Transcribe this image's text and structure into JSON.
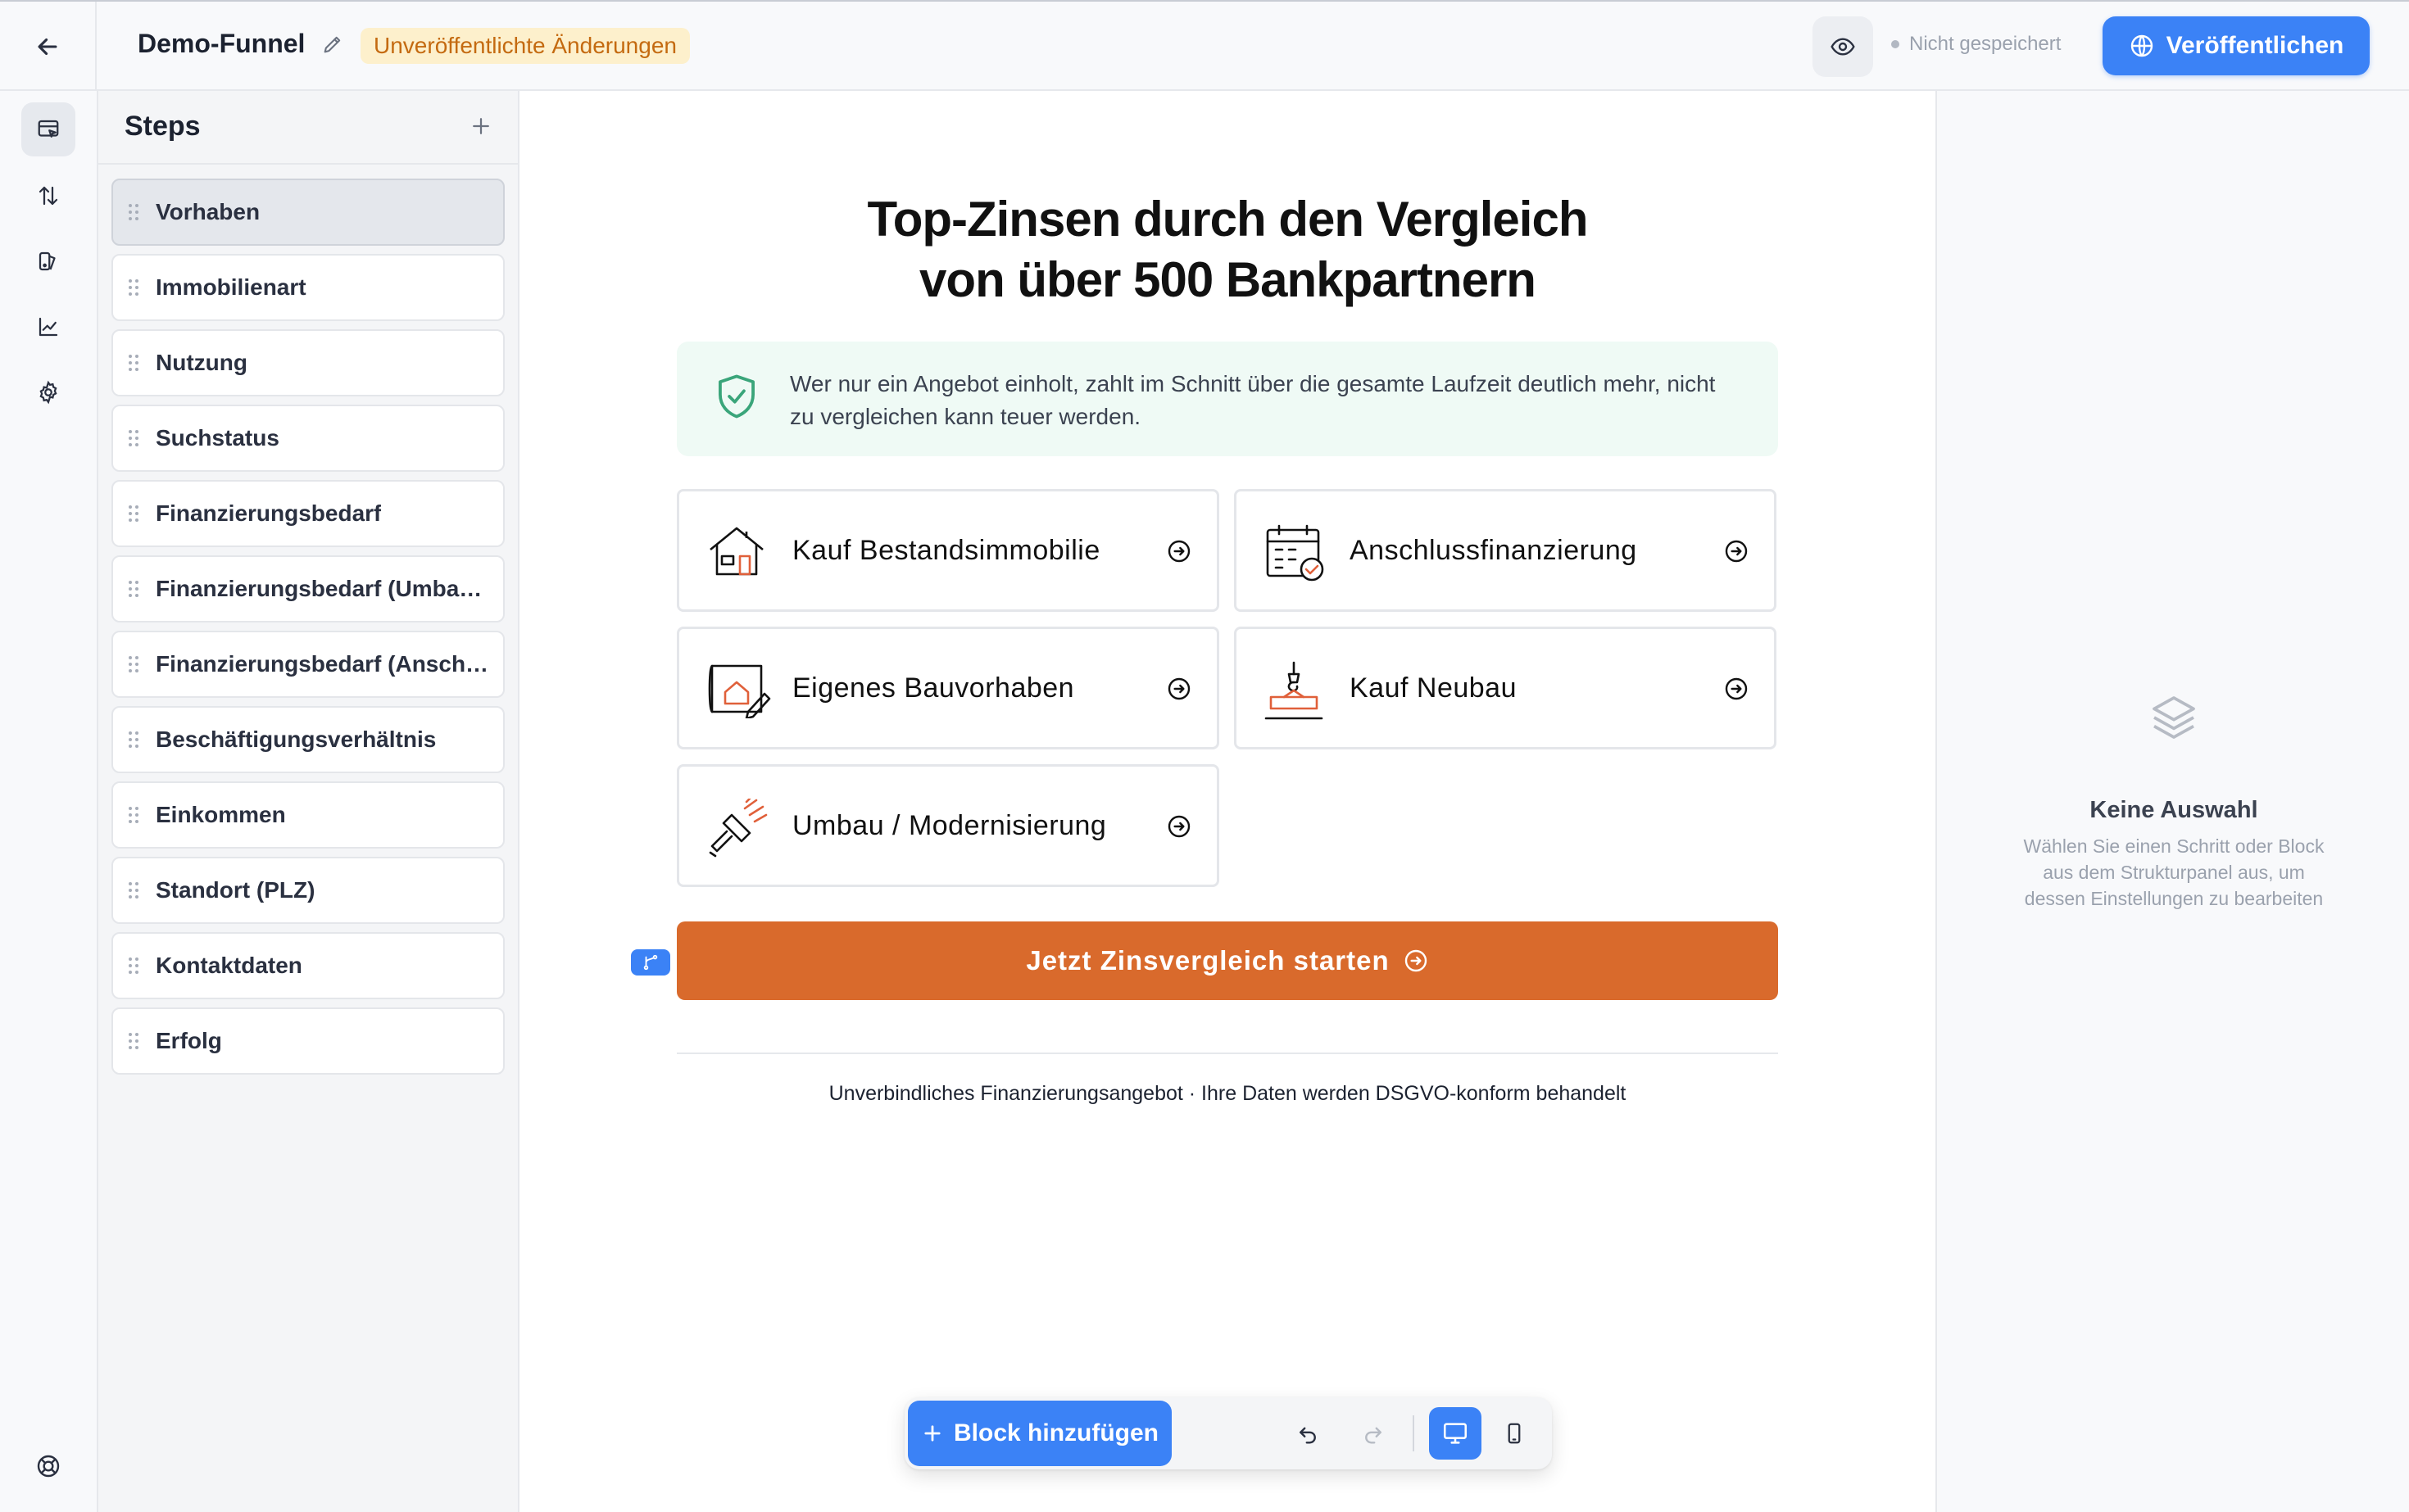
{
  "header": {
    "title": "Demo-Funnel",
    "unpublished_badge": "Unveröffentlichte Änderungen",
    "save_status": "Nicht gespeichert",
    "publish_label": "Veröffentlichen"
  },
  "steps_panel": {
    "title": "Steps",
    "items": [
      {
        "label": "Vorhaben",
        "active": true
      },
      {
        "label": "Immobilienart"
      },
      {
        "label": "Nutzung"
      },
      {
        "label": "Suchstatus"
      },
      {
        "label": "Finanzierungsbedarf"
      },
      {
        "label": "Finanzierungsbedarf (Umbau / Modernisierung)"
      },
      {
        "label": "Finanzierungsbedarf (Anschlussfinanzierung)"
      },
      {
        "label": "Beschäftigungsverhältnis"
      },
      {
        "label": "Einkommen"
      },
      {
        "label": "Standort (PLZ)"
      },
      {
        "label": "Kontaktdaten"
      },
      {
        "label": "Erfolg"
      }
    ]
  },
  "canvas": {
    "headline_line1": "Top-Zinsen durch den Vergleich",
    "headline_line2": "von über 500 Bankpartnern",
    "info_text": "Wer nur ein Angebot einholt, zahlt im Schnitt über die gesamte Laufzeit deutlich mehr, nicht zu vergleichen kann teuer werden.",
    "options": [
      {
        "label": "Kauf Bestandsimmobilie",
        "icon": "house-icon"
      },
      {
        "label": "Anschlussfinanzierung",
        "icon": "calendar-check-icon"
      },
      {
        "label": "Eigenes Bauvorhaben",
        "icon": "blueprint-icon"
      },
      {
        "label": "Kauf Neubau",
        "icon": "crane-icon"
      },
      {
        "label": "Umbau / Modernisierung",
        "icon": "paint-roller-icon"
      }
    ],
    "cta_label": "Jetzt Zinsvergleich starten",
    "disclaimer": "Unverbindliches Finanzierungsangebot · Ihre Daten werden DSGVO-konform behandelt"
  },
  "toolbar": {
    "add_block_label": "Block hinzufügen",
    "active_device": "desktop"
  },
  "settings_panel": {
    "empty_title": "Keine Auswahl",
    "empty_desc": "Wählen Sie einen Schritt oder Block aus dem Strukturpanel aus, um dessen Einstellungen zu bearbeiten"
  },
  "colors": {
    "accent": "#3b82f6",
    "cta": "#d96a2c",
    "badge_bg": "#fdf0cc",
    "badge_text": "#c46a10",
    "info_bg": "#effaf5",
    "icon_accent": "#e0603a"
  }
}
